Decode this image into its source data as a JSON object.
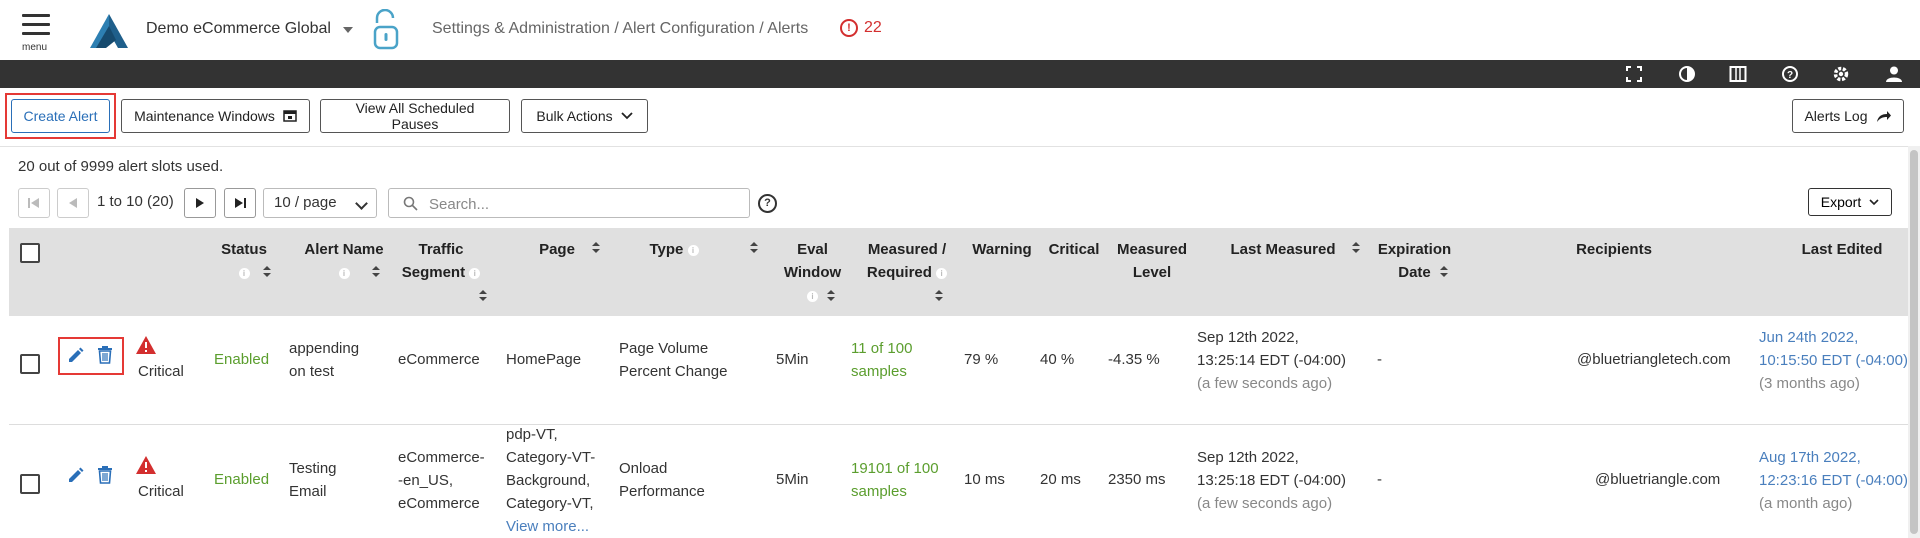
{
  "header": {
    "menu_label": "menu",
    "org_name": "Demo eCommerce Global",
    "breadcrumb": "Settings & Administration / Alert Configuration / Alerts",
    "alert_count": "22"
  },
  "toolbar": {
    "create_alert": "Create Alert",
    "maintenance_windows": "Maintenance Windows",
    "view_scheduled_pauses": "View All Scheduled Pauses",
    "bulk_actions": "Bulk Actions",
    "alerts_log": "Alerts Log"
  },
  "slots_text": "20 out of 9999 alert slots used.",
  "pagination": {
    "range": "1 to 10 (20)",
    "per_page": "10 / page",
    "search_placeholder": "Search...",
    "export": "Export"
  },
  "table": {
    "columns": {
      "status": "Status",
      "alert_name": "Alert Name",
      "traffic_segment_1": "Traffic",
      "traffic_segment_2": "Segment",
      "page": "Page",
      "type": "Type",
      "eval_window_1": "Eval",
      "eval_window_2": "Window",
      "measured_required_1": "Measured /",
      "measured_required_2": "Required",
      "warning": "Warning",
      "critical": "Critical",
      "measured_level_1": "Measured",
      "measured_level_2": "Level",
      "last_measured": "Last Measured",
      "expiration_date_1": "Expiration",
      "expiration_date_2": "Date",
      "recipients": "Recipients",
      "last_edited": "Last Edited"
    },
    "rows": [
      {
        "severity": "Critical",
        "status": "Enabled",
        "alert_name_1": "appending",
        "alert_name_2": "on test",
        "traffic_segment_1": "eCommerce",
        "page_1": "HomePage",
        "type_1": "Page Volume",
        "type_2": "Percent Change",
        "eval_window": "5Min",
        "measured_1": "11 of 100",
        "measured_2": "samples",
        "warning": "79 %",
        "critical": "40 %",
        "measured_level": "-4.35 %",
        "last_measured_1": "Sep 12th 2022,",
        "last_measured_2": "13:25:14 EDT (-04:00)",
        "last_measured_3": "(a few seconds ago)",
        "expiration": "-",
        "recipients": "@bluetriangletech.com",
        "last_edited_1": "Jun 24th 2022,",
        "last_edited_2": "10:15:50 EDT (-04:00)",
        "last_edited_3": "(3 months ago)"
      },
      {
        "severity": "Critical",
        "status": "Enabled",
        "alert_name_1": "Testing",
        "alert_name_2": "Email",
        "traffic_segment_1": "eCommerce-",
        "traffic_segment_2": "-en_US,",
        "traffic_segment_3": "eCommerce",
        "page_1": "pdp-VT,",
        "page_2": "Category-VT-",
        "page_3": "Background,",
        "page_4": "Category-VT,",
        "page_more": "View more...",
        "type_1": "Onload",
        "type_2": "Performance",
        "eval_window": "5Min",
        "measured_1": "19101 of 100",
        "measured_2": "samples",
        "warning": "10 ms",
        "critical": "20 ms",
        "measured_level": "2350 ms",
        "last_measured_1": "Sep 12th 2022,",
        "last_measured_2": "13:25:18 EDT (-04:00)",
        "last_measured_3": "(a few seconds ago)",
        "expiration": "-",
        "recipients": "@bluetriangle.com",
        "last_edited_1": "Aug 17th 2022,",
        "last_edited_2": "12:23:16 EDT (-04:00)",
        "last_edited_3": "(a month ago)"
      }
    ]
  },
  "icons": {
    "fullscreen": "fullscreen-icon",
    "contrast": "contrast-icon",
    "columns": "columns-icon",
    "help": "help-icon",
    "settings": "gear-icon",
    "user": "user-icon"
  },
  "colors": {
    "accent": "#2a6fb8",
    "enabled": "#5b9e2e",
    "critical": "#d32f2f",
    "highlight": "#e53935",
    "link": "#4a7fbd"
  }
}
